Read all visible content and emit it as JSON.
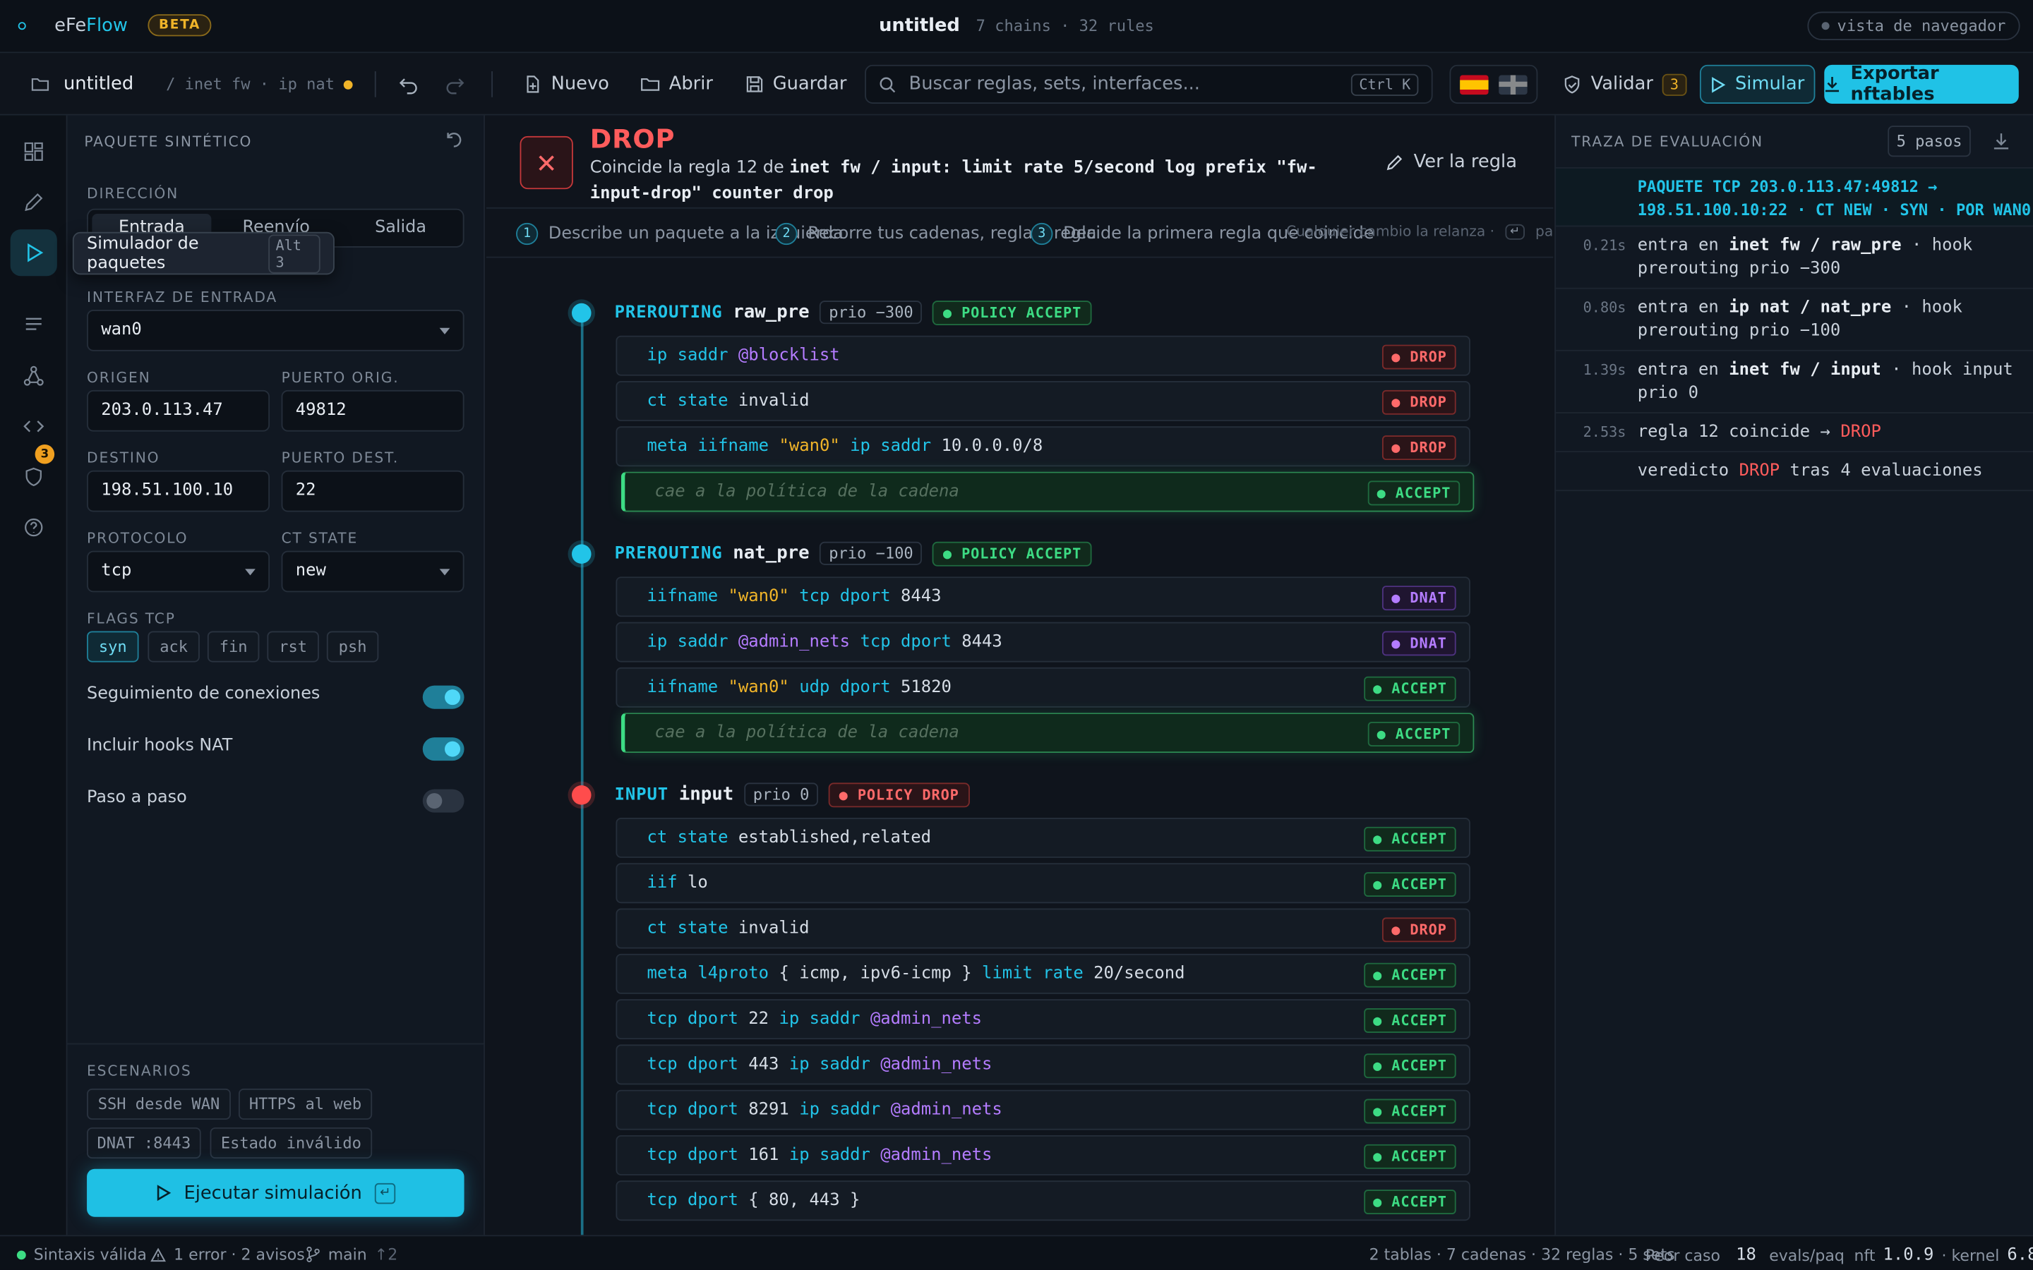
{
  "app": {
    "brand_prefix": "eFe",
    "brand_suffix": "Flow",
    "beta": "BETA",
    "title": "untitled",
    "subtitle": "7 chains · 32 rules",
    "view_mode": "vista de navegador"
  },
  "toolbar": {
    "file_name": "untitled",
    "breadcrumb": "/ inet fw · ip nat",
    "new_label": "Nuevo",
    "open_label": "Abrir",
    "save_label": "Guardar",
    "search_placeholder": "Buscar reglas, sets, interfaces...",
    "search_shortcut": "Ctrl K",
    "validate_label": "Validar",
    "validate_count": "3",
    "simulate_label": "Simular",
    "export_label": "Exportar nftables"
  },
  "rail": {
    "badge_count": "3",
    "tooltip_label": "Simulador de paquetes",
    "tooltip_shortcut": "Alt 3"
  },
  "packet_form": {
    "title": "PAQUETE SINTÉTICO",
    "direction_label": "DIRECCIÓN",
    "directions": [
      "Entrada",
      "Reenvío",
      "Salida"
    ],
    "selected_direction": "Entrada",
    "iface_label": "INTERFAZ DE ENTRADA",
    "iface_value": "wan0",
    "src_label": "ORIGEN",
    "src_value": "203.0.113.47",
    "sport_label": "PUERTO ORIG.",
    "sport_value": "49812",
    "dst_label": "DESTINO",
    "dst_value": "198.51.100.10",
    "dport_label": "PUERTO DEST.",
    "dport_value": "22",
    "proto_label": "PROTOCOLO",
    "proto_value": "tcp",
    "ct_label": "CT STATE",
    "ct_value": "new",
    "flags_label": "FLAGS TCP",
    "flags": [
      "syn",
      "ack",
      "fin",
      "rst",
      "psh"
    ],
    "active_flag": "syn",
    "toggles": [
      {
        "label": "Seguimiento de conexiones",
        "on": true
      },
      {
        "label": "Incluir hooks NAT",
        "on": true
      },
      {
        "label": "Paso a paso",
        "on": false
      }
    ],
    "scenarios_label": "ESCENARIOS",
    "scenarios": [
      "SSH desde WAN",
      "HTTPS al web",
      "DNAT :8443",
      "Estado inválido"
    ],
    "run_label": "Ejecutar simulación",
    "run_shortcut": "↵"
  },
  "verdict": {
    "title": "DROP",
    "desc_prefix": "Coincide la regla 12 de",
    "desc_chain": "inet fw / input",
    "desc_rule": ": limit rate 5/second log prefix \"fw-input-drop\" counter drop",
    "view_rule": "Ver la regla"
  },
  "steps": [
    {
      "num": "1",
      "text": "Describe un paquete a la izquierda"
    },
    {
      "num": "2",
      "text": "Recorre tus cadenas, regla a regla"
    },
    {
      "num": "3",
      "text": "Decide la primera regla que coincide"
    }
  ],
  "steps_hint": "Cualquier cambio la relanza ·",
  "steps_hint_key": "↵",
  "steps_hint_end": "para r",
  "chains": [
    {
      "hook": "PREROUTING",
      "name": "raw_pre",
      "prio": "prio −300",
      "policy": "POLICY ACCEPT",
      "policy_type": "acc",
      "rules": [
        {
          "text": "ip saddr @blocklist",
          "action": "DROP",
          "type": "drp"
        },
        {
          "text": "ct state invalid",
          "action": "DROP",
          "type": "drp"
        },
        {
          "text": "meta iifname \"wan0\" ip saddr 10.0.0.0/8",
          "action": "DROP",
          "type": "drp"
        },
        {
          "text": "cae a la política de la cadena",
          "action": "ACCEPT",
          "type": "acc",
          "fall": true
        }
      ]
    },
    {
      "hook": "PREROUTING",
      "name": "nat_pre",
      "prio": "prio −100",
      "policy": "POLICY ACCEPT",
      "policy_type": "acc",
      "rules": [
        {
          "text": "iifname \"wan0\" tcp dport 8443",
          "action": "DNAT",
          "type": "dnat"
        },
        {
          "text": "ip saddr @admin_nets tcp dport 8443",
          "action": "DNAT",
          "type": "dnat"
        },
        {
          "text": "iifname \"wan0\" udp dport 51820",
          "action": "ACCEPT",
          "type": "acc"
        },
        {
          "text": "cae a la política de la cadena",
          "action": "ACCEPT",
          "type": "acc",
          "fall": true
        }
      ]
    },
    {
      "hook": "INPUT",
      "name": "input",
      "prio": "prio 0",
      "policy": "POLICY DROP",
      "policy_type": "drp",
      "rules": [
        {
          "text": "ct state established,related",
          "action": "ACCEPT",
          "type": "acc"
        },
        {
          "text": "iif lo",
          "action": "ACCEPT",
          "type": "acc"
        },
        {
          "text": "ct state invalid",
          "action": "DROP",
          "type": "drp"
        },
        {
          "text": "meta l4proto { icmp, ipv6-icmp } limit rate 20/second",
          "action": "ACCEPT",
          "type": "acc"
        },
        {
          "text": "tcp dport 22 ip saddr @admin_nets",
          "action": "ACCEPT",
          "type": "acc"
        },
        {
          "text": "tcp dport 443 ip saddr @admin_nets",
          "action": "ACCEPT",
          "type": "acc"
        },
        {
          "text": "tcp dport 8291 ip saddr @admin_nets",
          "action": "ACCEPT",
          "type": "acc"
        },
        {
          "text": "tcp dport 161 ip saddr @admin_nets",
          "action": "ACCEPT",
          "type": "acc"
        },
        {
          "text": "tcp dport { 80, 443 }",
          "action": "ACCEPT",
          "type": "acc"
        }
      ]
    }
  ],
  "trace": {
    "title": "TRAZA DE EVALUACIÓN",
    "steps_label": "5 pasos",
    "packet_line1": "PAQUETE TCP 203.0.113.47:49812 →",
    "packet_line2": "198.51.100.10:22 · CT NEW · SYN · POR WAN0",
    "entries": [
      {
        "time": "0.21s",
        "pre": "entra en",
        "bold": "inet fw / raw_pre",
        "post": " · hook prerouting prio −300"
      },
      {
        "time": "0.80s",
        "pre": "entra en",
        "bold": "ip nat / nat_pre",
        "post": " · hook prerouting prio −100"
      },
      {
        "time": "1.39s",
        "pre": "entra en",
        "bold": "inet fw / input",
        "post": " · hook input prio 0"
      },
      {
        "time": "2.53s",
        "pre": "regla 12 coincide →",
        "red": "DROP",
        "post": ""
      },
      {
        "time": "",
        "pre": "veredicto",
        "red": "DROP",
        "post": " tras 4 evaluaciones"
      }
    ]
  },
  "status": {
    "syntax": "Sintaxis válida",
    "problems": "1 error · 2 avisos",
    "branch": "main",
    "branch_ahead": "↑2",
    "summary": "2 tablas · 7 cadenas · 32 reglas · 5 sets",
    "worst_label": "Peor caso",
    "worst_value": "18",
    "worst_unit": "evals/paq",
    "nft_label": "nft",
    "nft_version": "1.0.9",
    "kernel_label": "· kernel",
    "kernel_version": "6.8"
  },
  "colors": {
    "accent": "#22c4e8",
    "accept": "#3ddc84",
    "drop": "#ff5c5c",
    "dnat": "#b47cff",
    "warning": "#f0b429"
  }
}
